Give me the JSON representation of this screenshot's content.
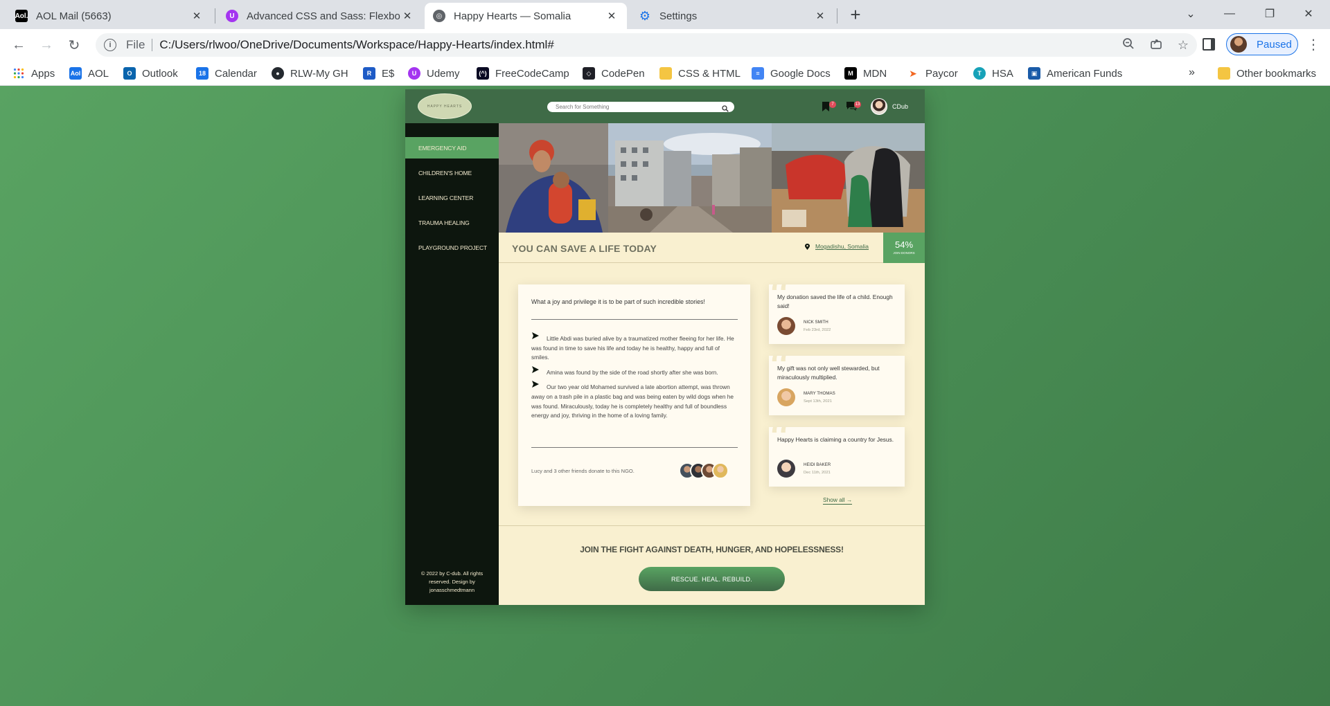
{
  "browser": {
    "tabs": [
      {
        "label": "AOL Mail (5663)",
        "icon": "aol-icon",
        "active": false
      },
      {
        "label": "Advanced CSS and Sass: Flexbox,",
        "icon": "udemy-icon",
        "active": false
      },
      {
        "label": "Happy Hearts — Somalia",
        "icon": "globe-icon",
        "active": true
      },
      {
        "label": "Settings",
        "icon": "gear-icon",
        "active": false
      }
    ],
    "address": {
      "scheme": "File",
      "url": "C:/Users/rlwoo/OneDrive/Documents/Workspace/Happy-Hearts/index.html#"
    },
    "profile_label": "Paused",
    "bookmarks": [
      {
        "label": "Apps",
        "icon": "apps-grid-icon",
        "color": "#4285f4"
      },
      {
        "label": "AOL",
        "icon": "aol-icon",
        "color": "#1a73e8"
      },
      {
        "label": "Outlook",
        "icon": "outlook-icon",
        "color": "#0a64ad"
      },
      {
        "label": "Calendar",
        "icon": "calendar-icon",
        "color": "#1a73e8",
        "badge": "18"
      },
      {
        "label": "RLW-My GH",
        "icon": "github-icon",
        "color": "#24292f"
      },
      {
        "label": "E$",
        "icon": "r-icon",
        "color": "#1e5bc6"
      },
      {
        "label": "Udemy",
        "icon": "udemy-icon",
        "color": "#a435f0"
      },
      {
        "label": "FreeCodeCamp",
        "icon": "freecodecamp-icon",
        "color": "#0a0a23"
      },
      {
        "label": "CodePen",
        "icon": "codepen-icon",
        "color": "#1e1f26"
      },
      {
        "label": "CSS & HTML",
        "icon": "folder-icon",
        "color": "#f4c542"
      },
      {
        "label": "Google Docs",
        "icon": "google-docs-icon",
        "color": "#4285f4"
      },
      {
        "label": "MDN",
        "icon": "mdn-icon",
        "color": "#000000"
      },
      {
        "label": "Paycor",
        "icon": "paycor-icon",
        "color": "#f26722"
      },
      {
        "label": "HSA",
        "icon": "hsa-icon",
        "color": "#17a2b8"
      },
      {
        "label": "American Funds",
        "icon": "american-funds-icon",
        "color": "#1a5ba8"
      }
    ],
    "more_bookmarks": "»",
    "other_bookmarks": "Other bookmarks"
  },
  "site": {
    "logo_text": "HAPPY HEARTS",
    "search_placeholder": "Search for Something",
    "notifications": {
      "bookmarks_count": "7",
      "chat_count": "13"
    },
    "user_name": "CDub",
    "nav": [
      {
        "label": "Emergency Aid",
        "active": true
      },
      {
        "label": "Children's Home",
        "active": false
      },
      {
        "label": "Learning Center",
        "active": false
      },
      {
        "label": "Trauma Healing",
        "active": false
      },
      {
        "label": "Playground Project",
        "active": false
      }
    ],
    "legal": "© 2022 by C-dub. All rights reserved. Design by jonasschmedtmann",
    "overview": {
      "title": "YOU CAN SAVE A LIFE TODAY",
      "location": "Mogadishu, Somalia",
      "percent": "54%",
      "percent_label": "JOIN DONORS",
      "percent_value": 0.54
    },
    "story": {
      "intro": "What a joy and privilege it is to be part of such incredible stories!",
      "items": [
        "Little Abdi was buried alive by a traumatized mother fleeing for her life. He was found in time to save his life and today he is healthy, happy and full of smiles.",
        "Amina was found by the side of the road shortly after she was born.",
        "Our two year old Mohamed survived a late abortion attempt, was thrown away on a trash pile in a plastic bag and was being eaten by wild dogs when he was found. Miraculously, today he is completely healthy and full of boundless energy and joy, thriving in the home of a loving family."
      ],
      "friends_text": "Lucy and 3 other friends donate to this NGO."
    },
    "reviews": [
      {
        "text": "My donation saved the life of a child. Enough said!",
        "name": "NICK SMITH",
        "date": "Feb 23rd, 2022"
      },
      {
        "text": "My gift was not only well stewarded, but miraculously multiplied.",
        "name": "MARY THOMAS",
        "date": "Sept 13th, 2021"
      },
      {
        "text": "Happy Hearts is claiming a country for Jesus.",
        "name": "HEIDI BAKER",
        "date": "Dec 11th, 2021"
      }
    ],
    "show_all": "Show all →",
    "cta": {
      "title": "JOIN THE FIGHT AGAINST DEATH, HUNGER, AND HOPELESSNESS!",
      "button": "RESCUE. HEAL. REBUILD."
    },
    "colors": {
      "primary": "#59a362",
      "dark": "#3f6b47",
      "cream": "#f9f0d0",
      "sidebar": "#0d160e"
    }
  }
}
